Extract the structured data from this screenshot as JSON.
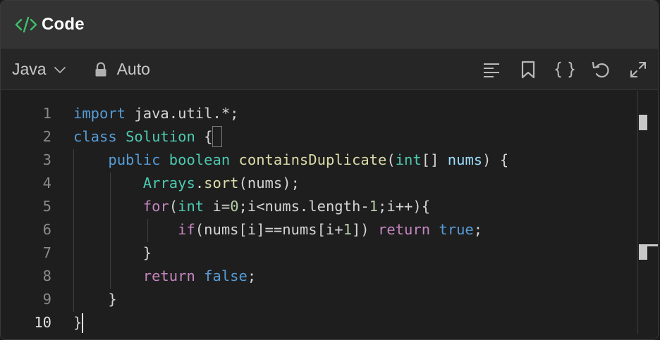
{
  "header": {
    "title": "Code",
    "icon": "code-brackets-icon",
    "icon_color": "#3fbf6a"
  },
  "toolbar": {
    "language": "Java",
    "mode": "Auto",
    "tools": [
      "format-icon",
      "bookmark-icon",
      "braces-icon",
      "reset-icon",
      "expand-icon"
    ]
  },
  "editor": {
    "active_line": 10,
    "lines": [
      {
        "num": "1",
        "tokens": [
          [
            "import",
            "kw-blue"
          ],
          [
            " java.util.*;",
            "plain"
          ]
        ]
      },
      {
        "num": "2",
        "tokens": [
          [
            "class",
            "kw-blue"
          ],
          [
            " ",
            "plain"
          ],
          [
            "Solution",
            "type"
          ],
          [
            " {",
            "plain"
          ]
        ]
      },
      {
        "num": "3",
        "tokens": [
          [
            "    ",
            "plain"
          ],
          [
            "public",
            "kw-blue"
          ],
          [
            " ",
            "plain"
          ],
          [
            "boolean",
            "type"
          ],
          [
            " ",
            "plain"
          ],
          [
            "containsDuplicate",
            "func"
          ],
          [
            "(",
            "plain"
          ],
          [
            "int",
            "type"
          ],
          [
            "[] ",
            "plain"
          ],
          [
            "nums",
            "var"
          ],
          [
            ") {",
            "plain"
          ]
        ]
      },
      {
        "num": "4",
        "tokens": [
          [
            "        ",
            "plain"
          ],
          [
            "Arrays",
            "type"
          ],
          [
            ".",
            "plain"
          ],
          [
            "sort",
            "func"
          ],
          [
            "(nums);",
            "plain"
          ]
        ]
      },
      {
        "num": "5",
        "tokens": [
          [
            "        ",
            "plain"
          ],
          [
            "for",
            "kw-purple"
          ],
          [
            "(",
            "plain"
          ],
          [
            "int",
            "type"
          ],
          [
            " i=",
            "plain"
          ],
          [
            "0",
            "num"
          ],
          [
            ";i<nums.length-",
            "plain"
          ],
          [
            "1",
            "num"
          ],
          [
            ";i++){",
            "plain"
          ]
        ]
      },
      {
        "num": "6",
        "tokens": [
          [
            "            ",
            "plain"
          ],
          [
            "if",
            "kw-purple"
          ],
          [
            "(nums[i]==nums[i+",
            "plain"
          ],
          [
            "1",
            "num"
          ],
          [
            "]) ",
            "plain"
          ],
          [
            "return",
            "kw-purple"
          ],
          [
            " ",
            "plain"
          ],
          [
            "true",
            "kw-blue"
          ],
          [
            ";",
            "plain"
          ]
        ]
      },
      {
        "num": "7",
        "tokens": [
          [
            "        }",
            "plain"
          ]
        ]
      },
      {
        "num": "8",
        "tokens": [
          [
            "        ",
            "plain"
          ],
          [
            "return",
            "kw-purple"
          ],
          [
            " ",
            "plain"
          ],
          [
            "false",
            "kw-blue"
          ],
          [
            ";",
            "plain"
          ]
        ]
      },
      {
        "num": "9",
        "tokens": [
          [
            "    }",
            "plain"
          ]
        ]
      },
      {
        "num": "10",
        "tokens": [
          [
            "}",
            "plain"
          ]
        ]
      }
    ]
  },
  "colors": {
    "kw-blue": "#569cd6",
    "kw-purple": "#c586c0",
    "type": "#4ec9b0",
    "func": "#dcdcaa",
    "var": "#9cdcfe",
    "num": "#b5cea8",
    "plain": "#d4d4d4"
  }
}
